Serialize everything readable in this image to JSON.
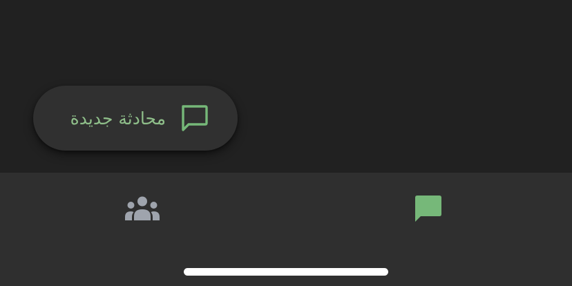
{
  "fab": {
    "label": "محادثة جديدة",
    "icon": "chat-bubble-outline-icon"
  },
  "bottom_nav": {
    "items": [
      {
        "icon": "people-group-icon",
        "selected": false
      },
      {
        "icon": "chat-bubble-filled-icon",
        "selected": true
      }
    ]
  },
  "colors": {
    "background": "#212121",
    "nav_background": "#2f2f2f",
    "fab_background": "#303030",
    "accent_green": "#76b879",
    "fab_text": "#8fbf8a",
    "inactive_icon": "#9fa4ad",
    "home_indicator": "#ffffff"
  }
}
